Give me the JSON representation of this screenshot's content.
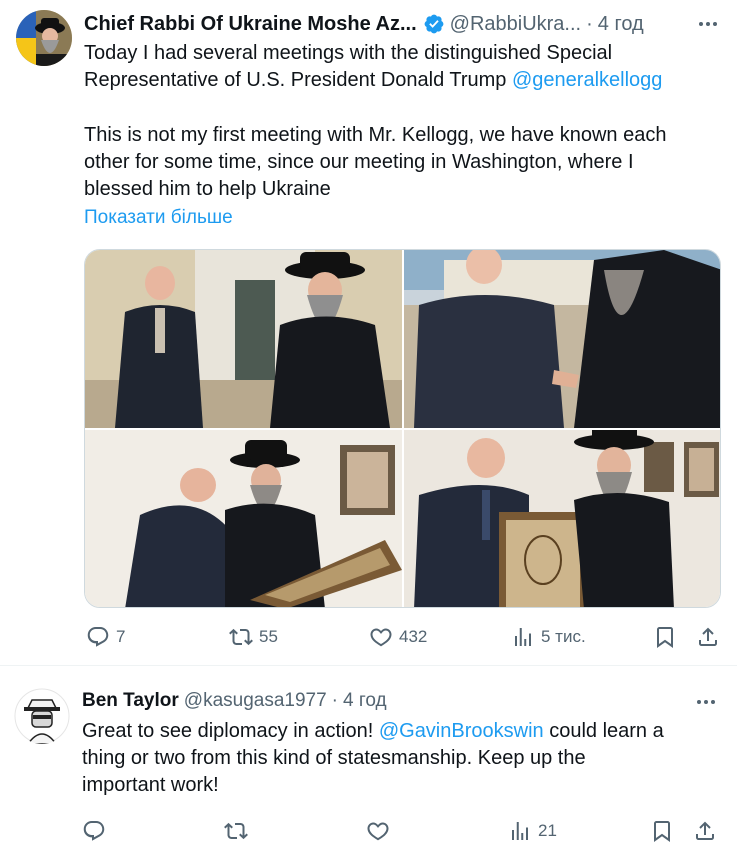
{
  "main_tweet": {
    "author_name": "Chief Rabbi Of Ukraine Moshe Az...",
    "handle": "@RabbiUkra...",
    "separator": "·",
    "time": "4 год",
    "text_line1": "Today I had several meetings with the distinguished Special",
    "text_line2_prefix": "Representative of U.S. President Donald Trump ",
    "mention": "@generalkellogg",
    "para2_line1": "This is not my first meeting with Mr. Kellogg, we have known each",
    "para2_line2": "other for some time, since our meeting in Washington, where I",
    "para2_line3": "blessed him to help Ukraine",
    "show_more": "Показати більше",
    "stats": {
      "replies": "7",
      "reposts": "55",
      "likes": "432",
      "views": "5 тис."
    }
  },
  "reply_tweet": {
    "author_name": "Ben Taylor",
    "handle": "@kasugasa1977",
    "separator": "·",
    "time": "4 год",
    "text_line1_prefix": "Great to see diplomacy in action! ",
    "mention": "@GavinBrookswin",
    "text_line1_suffix": " could learn a",
    "text_line2": "thing or two from this kind of statesmanship. Keep up the",
    "text_line3": "important work!",
    "stats": {
      "replies": "",
      "reposts": "",
      "likes": "",
      "views": "21"
    }
  },
  "icons": {
    "verified": "verified-badge-icon",
    "more": "more-dots-icon",
    "reply": "reply-icon",
    "repost": "repost-icon",
    "like": "like-icon",
    "views": "views-icon",
    "bookmark": "bookmark-icon",
    "share": "share-icon"
  },
  "colors": {
    "accent": "#1d9bf0",
    "secondary_text": "#536471",
    "primary_text": "#0f1419"
  }
}
